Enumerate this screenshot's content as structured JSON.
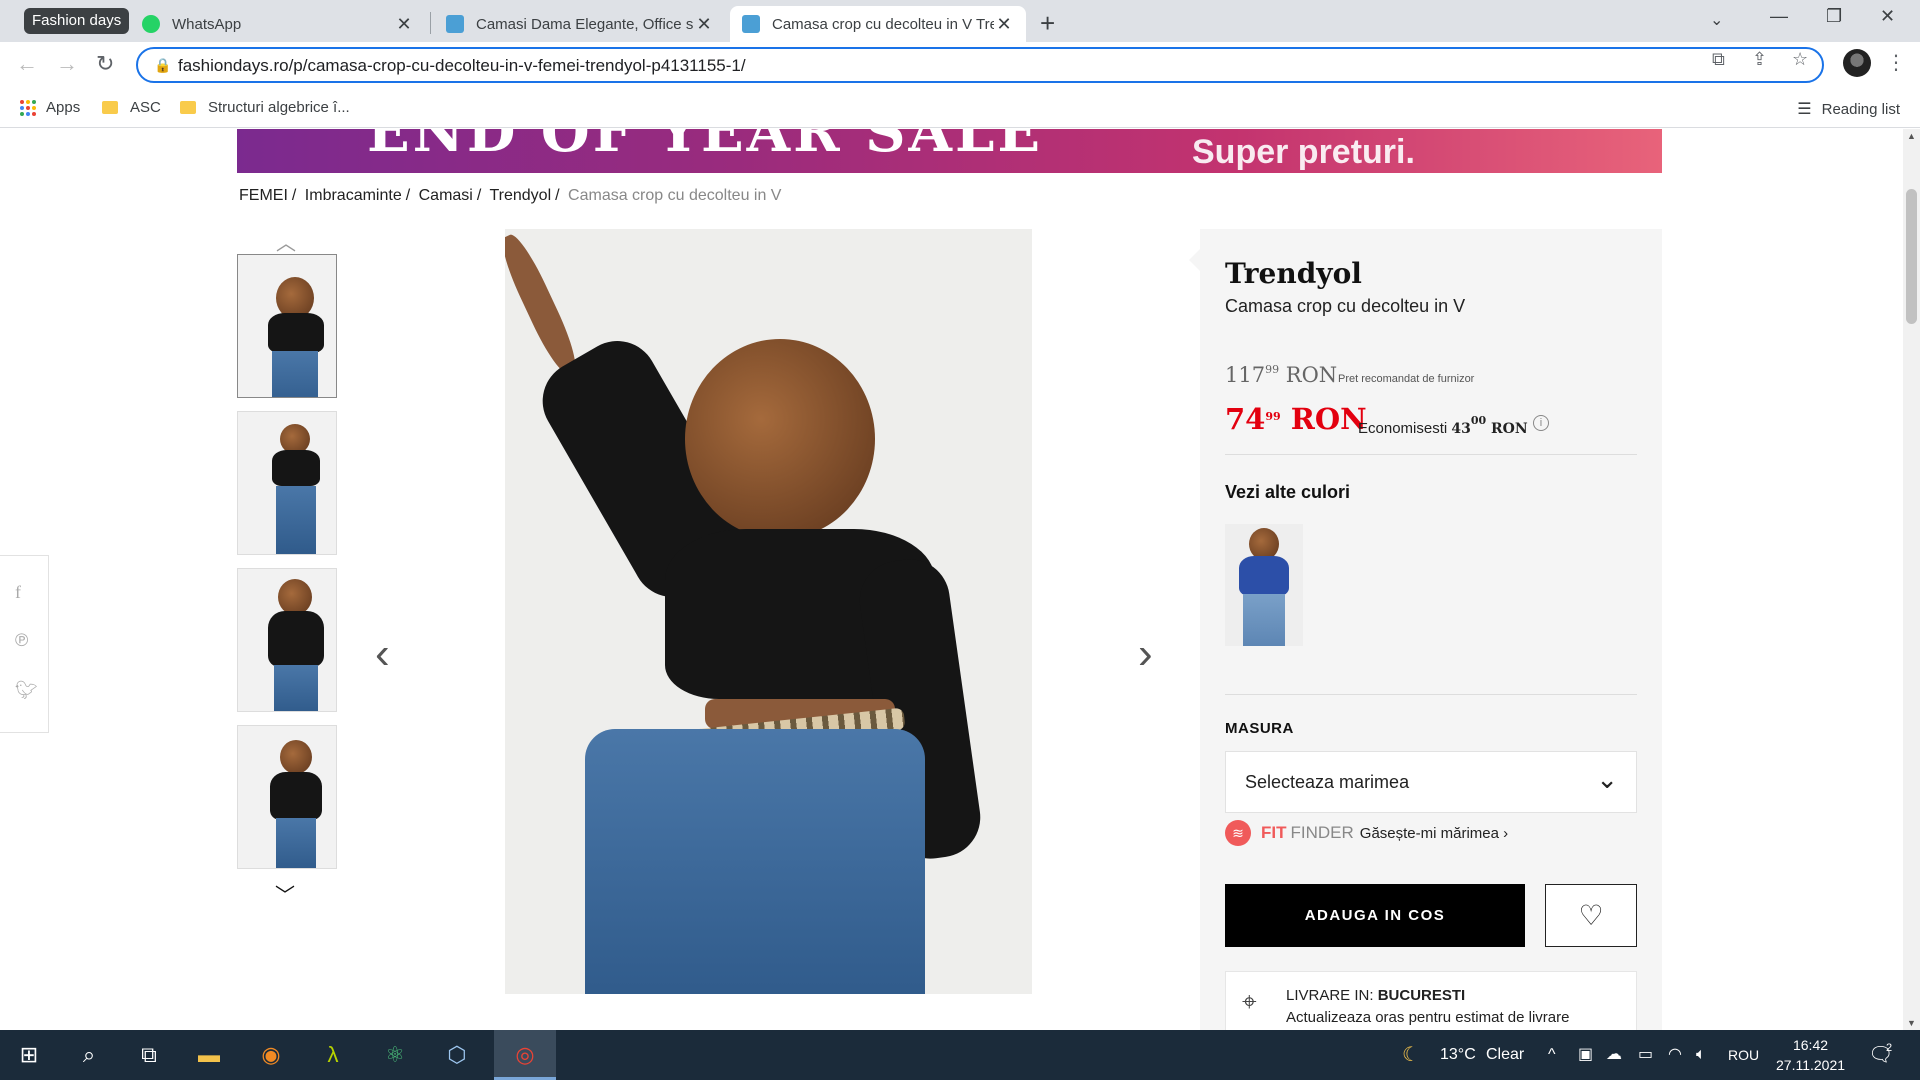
{
  "browser": {
    "tab_group": "Fashion days",
    "tabs": [
      {
        "title": "WhatsApp",
        "favicon_color": "#25d366"
      },
      {
        "title": "Camasi Dama Elegante, Office si ",
        "favicon_color": "#4b9fd5"
      },
      {
        "title": "Camasa crop cu decolteu in V Tre",
        "favicon_color": "#4b9fd5",
        "active": true
      }
    ],
    "url": "fashiondays.ro/p/camasa-crop-cu-decolteu-in-v-femei-trendyol-p4131155-1/",
    "bookmarks": [
      "Apps",
      "ASC",
      "Structuri algebrice î..."
    ],
    "reading_list": "Reading list"
  },
  "page": {
    "banner": {
      "big_text": "END OF YEAR SALE",
      "small_text": "Super preturi."
    },
    "breadcrumb": {
      "items": [
        "FEMEI",
        "Imbracaminte",
        "Camasi",
        "Trendyol"
      ],
      "current": "Camasa crop cu decolteu in V"
    },
    "product": {
      "brand": "Trendyol",
      "name": "Camasa crop cu decolteu in V",
      "old_price_int": "117",
      "old_price_dec": "99",
      "old_price_currency": "RON",
      "rrp_label": "Pret recomandat de furnizor",
      "price_int": "74",
      "price_dec": "99",
      "price_currency": "RON",
      "save_label": "Economisesti",
      "save_int": "43",
      "save_dec": "00",
      "save_currency": "RON"
    },
    "other_colors_title": "Vezi alte culori",
    "size": {
      "label": "MASURA",
      "placeholder": "Selecteaza marimea"
    },
    "fit_finder": {
      "fit": "FIT",
      "finder": "FINDER",
      "link": "Găsește-mi mărimea ›"
    },
    "add_to_cart": "ADAUGA IN COS",
    "delivery": {
      "prefix": "LIVRARE IN:",
      "city": "BUCURESTI",
      "update": "Actualizeaza oras pentru estimat de livrare"
    },
    "colors": {
      "accent_red": "#e3000f",
      "fit_finder": "#f05a5a"
    }
  },
  "taskbar": {
    "weather_temp": "13°C",
    "weather_text": "Clear",
    "language": "ROU",
    "time": "16:42",
    "date": "27.11.2021",
    "notifications": "2"
  }
}
